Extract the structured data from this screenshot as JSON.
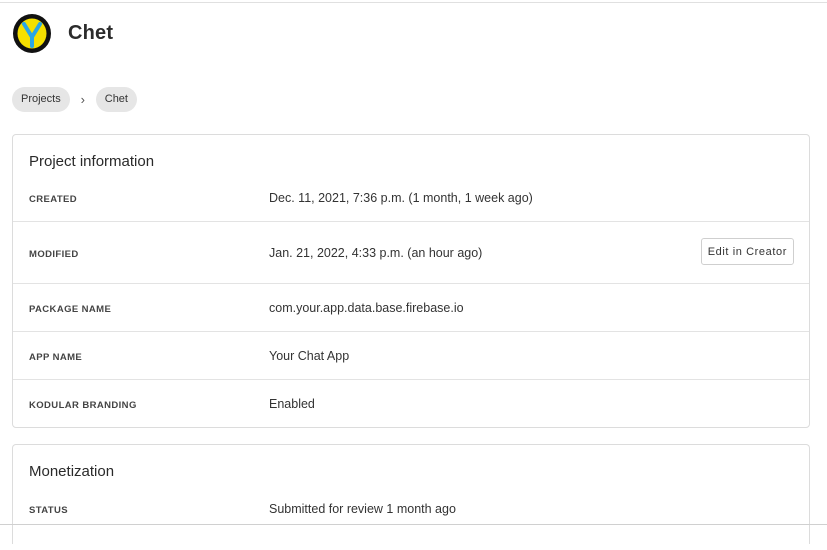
{
  "app": {
    "title": "Chet",
    "logo_icon": "kodular-logo-icon",
    "colors": {
      "logo_yellow": "#f5e000",
      "logo_blue": "#2aa6e6",
      "logo_dark": "#111111"
    }
  },
  "breadcrumb": {
    "items": [
      {
        "label": "Projects"
      },
      {
        "label": "Chet"
      }
    ],
    "separator": "›"
  },
  "project_info": {
    "title": "Project information",
    "rows": [
      {
        "label": "CREATED",
        "value": "Dec. 11, 2021, 7:36 p.m. (1 month, 1 week ago)"
      },
      {
        "label": "MODIFIED",
        "value": "Jan. 21, 2022, 4:33 p.m. (an hour ago)",
        "action_label": "Edit in Creator"
      },
      {
        "label": "PACKAGE NAME",
        "value": "com.your.app.data.base.firebase.io"
      },
      {
        "label": "APP NAME",
        "value": "Your Chat App"
      },
      {
        "label": "KODULAR BRANDING",
        "value": "Enabled"
      }
    ]
  },
  "monetization": {
    "title": "Monetization",
    "rows": [
      {
        "label": "STATUS",
        "value": "Submitted for review 1 month ago"
      }
    ]
  }
}
